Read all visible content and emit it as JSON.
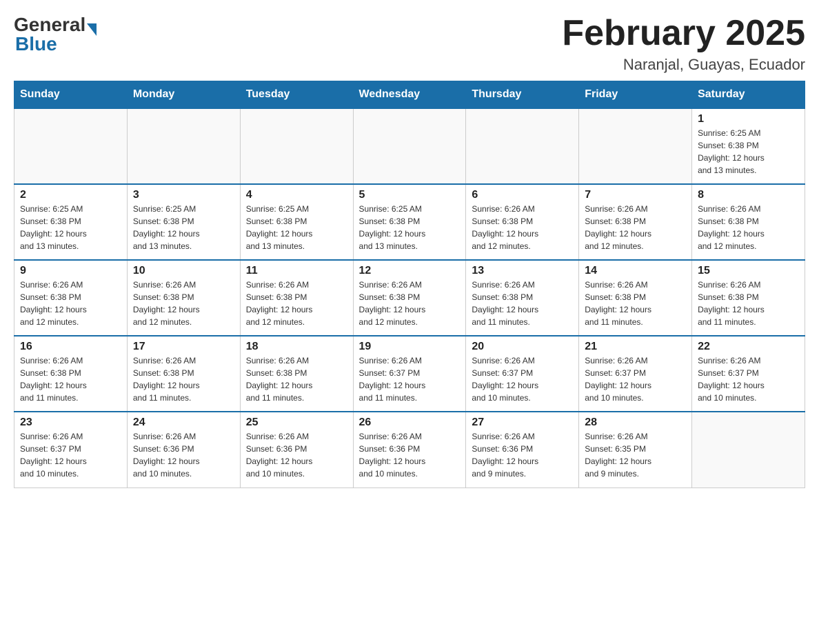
{
  "header": {
    "logo_general": "General",
    "logo_blue": "Blue",
    "month_title": "February 2025",
    "location": "Naranjal, Guayas, Ecuador"
  },
  "weekdays": [
    "Sunday",
    "Monday",
    "Tuesday",
    "Wednesday",
    "Thursday",
    "Friday",
    "Saturday"
  ],
  "weeks": [
    [
      {
        "day": "",
        "info": ""
      },
      {
        "day": "",
        "info": ""
      },
      {
        "day": "",
        "info": ""
      },
      {
        "day": "",
        "info": ""
      },
      {
        "day": "",
        "info": ""
      },
      {
        "day": "",
        "info": ""
      },
      {
        "day": "1",
        "info": "Sunrise: 6:25 AM\nSunset: 6:38 PM\nDaylight: 12 hours\nand 13 minutes."
      }
    ],
    [
      {
        "day": "2",
        "info": "Sunrise: 6:25 AM\nSunset: 6:38 PM\nDaylight: 12 hours\nand 13 minutes."
      },
      {
        "day": "3",
        "info": "Sunrise: 6:25 AM\nSunset: 6:38 PM\nDaylight: 12 hours\nand 13 minutes."
      },
      {
        "day": "4",
        "info": "Sunrise: 6:25 AM\nSunset: 6:38 PM\nDaylight: 12 hours\nand 13 minutes."
      },
      {
        "day": "5",
        "info": "Sunrise: 6:25 AM\nSunset: 6:38 PM\nDaylight: 12 hours\nand 13 minutes."
      },
      {
        "day": "6",
        "info": "Sunrise: 6:26 AM\nSunset: 6:38 PM\nDaylight: 12 hours\nand 12 minutes."
      },
      {
        "day": "7",
        "info": "Sunrise: 6:26 AM\nSunset: 6:38 PM\nDaylight: 12 hours\nand 12 minutes."
      },
      {
        "day": "8",
        "info": "Sunrise: 6:26 AM\nSunset: 6:38 PM\nDaylight: 12 hours\nand 12 minutes."
      }
    ],
    [
      {
        "day": "9",
        "info": "Sunrise: 6:26 AM\nSunset: 6:38 PM\nDaylight: 12 hours\nand 12 minutes."
      },
      {
        "day": "10",
        "info": "Sunrise: 6:26 AM\nSunset: 6:38 PM\nDaylight: 12 hours\nand 12 minutes."
      },
      {
        "day": "11",
        "info": "Sunrise: 6:26 AM\nSunset: 6:38 PM\nDaylight: 12 hours\nand 12 minutes."
      },
      {
        "day": "12",
        "info": "Sunrise: 6:26 AM\nSunset: 6:38 PM\nDaylight: 12 hours\nand 12 minutes."
      },
      {
        "day": "13",
        "info": "Sunrise: 6:26 AM\nSunset: 6:38 PM\nDaylight: 12 hours\nand 11 minutes."
      },
      {
        "day": "14",
        "info": "Sunrise: 6:26 AM\nSunset: 6:38 PM\nDaylight: 12 hours\nand 11 minutes."
      },
      {
        "day": "15",
        "info": "Sunrise: 6:26 AM\nSunset: 6:38 PM\nDaylight: 12 hours\nand 11 minutes."
      }
    ],
    [
      {
        "day": "16",
        "info": "Sunrise: 6:26 AM\nSunset: 6:38 PM\nDaylight: 12 hours\nand 11 minutes."
      },
      {
        "day": "17",
        "info": "Sunrise: 6:26 AM\nSunset: 6:38 PM\nDaylight: 12 hours\nand 11 minutes."
      },
      {
        "day": "18",
        "info": "Sunrise: 6:26 AM\nSunset: 6:38 PM\nDaylight: 12 hours\nand 11 minutes."
      },
      {
        "day": "19",
        "info": "Sunrise: 6:26 AM\nSunset: 6:37 PM\nDaylight: 12 hours\nand 11 minutes."
      },
      {
        "day": "20",
        "info": "Sunrise: 6:26 AM\nSunset: 6:37 PM\nDaylight: 12 hours\nand 10 minutes."
      },
      {
        "day": "21",
        "info": "Sunrise: 6:26 AM\nSunset: 6:37 PM\nDaylight: 12 hours\nand 10 minutes."
      },
      {
        "day": "22",
        "info": "Sunrise: 6:26 AM\nSunset: 6:37 PM\nDaylight: 12 hours\nand 10 minutes."
      }
    ],
    [
      {
        "day": "23",
        "info": "Sunrise: 6:26 AM\nSunset: 6:37 PM\nDaylight: 12 hours\nand 10 minutes."
      },
      {
        "day": "24",
        "info": "Sunrise: 6:26 AM\nSunset: 6:36 PM\nDaylight: 12 hours\nand 10 minutes."
      },
      {
        "day": "25",
        "info": "Sunrise: 6:26 AM\nSunset: 6:36 PM\nDaylight: 12 hours\nand 10 minutes."
      },
      {
        "day": "26",
        "info": "Sunrise: 6:26 AM\nSunset: 6:36 PM\nDaylight: 12 hours\nand 10 minutes."
      },
      {
        "day": "27",
        "info": "Sunrise: 6:26 AM\nSunset: 6:36 PM\nDaylight: 12 hours\nand 9 minutes."
      },
      {
        "day": "28",
        "info": "Sunrise: 6:26 AM\nSunset: 6:35 PM\nDaylight: 12 hours\nand 9 minutes."
      },
      {
        "day": "",
        "info": ""
      }
    ]
  ]
}
